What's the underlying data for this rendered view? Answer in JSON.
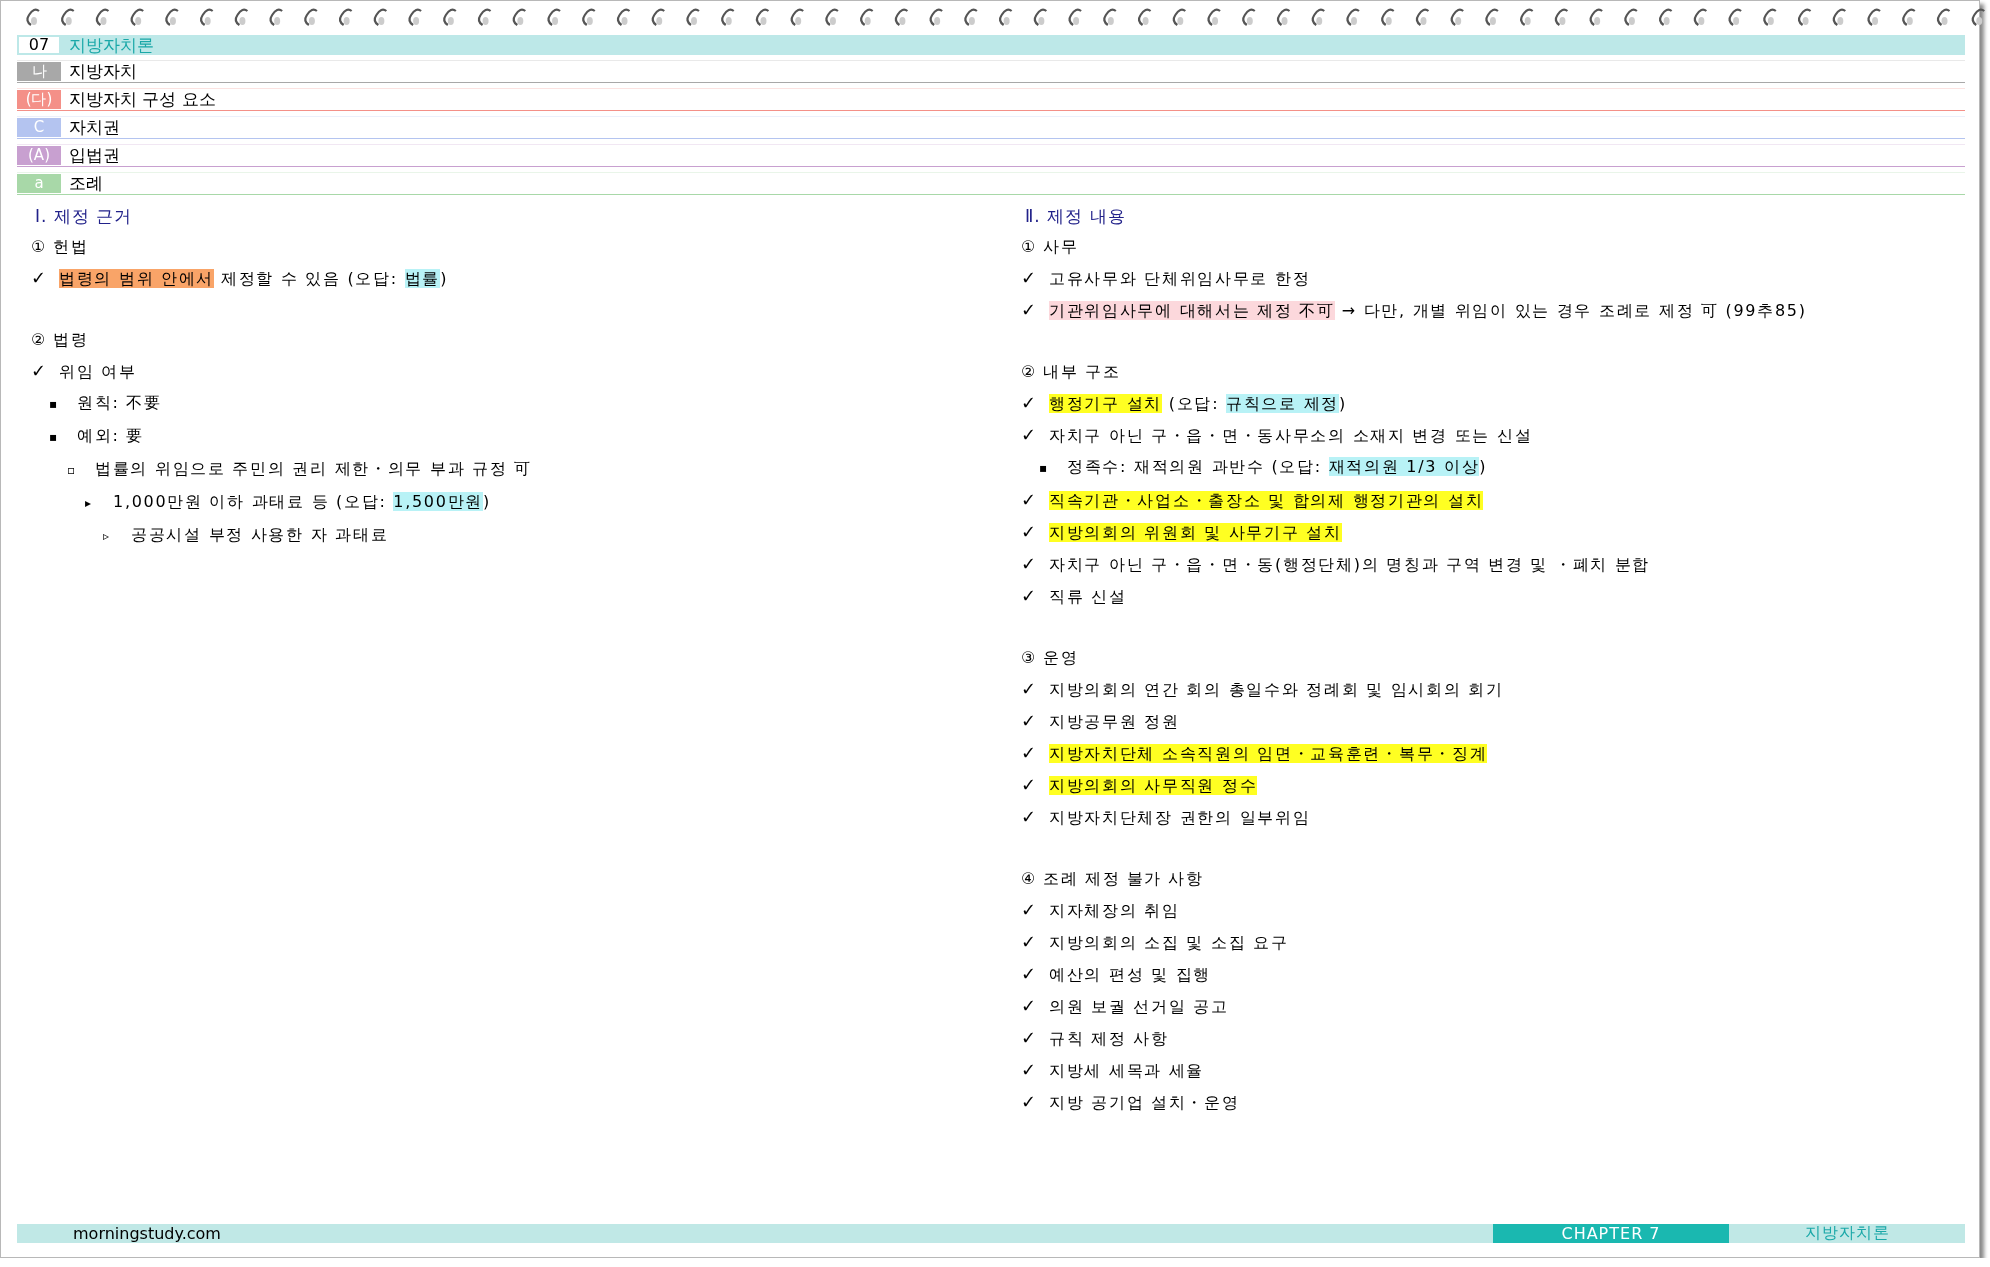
{
  "chapter": {
    "number": "07",
    "title": "지방자치론"
  },
  "crumbs": [
    {
      "marker": "나",
      "label": "지방자치",
      "color": "#a8a8a8"
    },
    {
      "marker": "(다)",
      "label": "지방자치 구성 요소",
      "color": "#f49088"
    },
    {
      "marker": "C",
      "label": "자치권",
      "color": "#b4c4f0"
    },
    {
      "marker": "(A)",
      "label": "입법권",
      "color": "#c8a0d0"
    },
    {
      "marker": "a",
      "label": "조례",
      "color": "#a8d8a8"
    }
  ],
  "columns": [
    {
      "title": "Ⅰ. 제정 근거",
      "sections": [
        {
          "heading": "① 헌법",
          "items": [
            {
              "marker": "✓",
              "segments": [
                {
                  "text": "법령의 범위 안에서",
                  "color": "#f9a468"
                },
                {
                  "text": " 제정할 수 있음 (오답: "
                },
                {
                  "text": "법률",
                  "color": "#b8f2f6"
                },
                {
                  "text": ")"
                }
              ]
            }
          ]
        },
        {
          "heading": "② 법령",
          "items": [
            {
              "marker": "✓",
              "segments": [
                {
                  "text": "위임 여부"
                }
              ],
              "children": [
                {
                  "marker": "▪",
                  "segments": [
                    {
                      "text": "원칙: 不要"
                    }
                  ]
                },
                {
                  "marker": "▪",
                  "segments": [
                    {
                      "text": "예외: 要"
                    }
                  ],
                  "children": [
                    {
                      "marker": "▫",
                      "segments": [
                        {
                          "text": "법률의 위임으로 주민의 권리 제한・의무 부과 규정 可"
                        }
                      ],
                      "children": [
                        {
                          "marker": "▸",
                          "segments": [
                            {
                              "text": "1,000만원 이하 과태료 등 (오답: "
                            },
                            {
                              "text": "1,500만원",
                              "color": "#b8f2f6"
                            },
                            {
                              "text": ")"
                            }
                          ],
                          "children": [
                            {
                              "marker": "▹",
                              "segments": [
                                {
                                  "text": "공공시설 부정 사용한 자 과태료"
                                }
                              ]
                            }
                          ]
                        }
                      ]
                    }
                  ]
                }
              ]
            }
          ]
        }
      ]
    },
    {
      "title": "Ⅱ. 제정 내용",
      "sections": [
        {
          "heading": "① 사무",
          "items": [
            {
              "marker": "✓",
              "segments": [
                {
                  "text": "고유사무와 단체위임사무로 한정"
                }
              ]
            },
            {
              "marker": "✓",
              "segments": [
                {
                  "text": "기관위임사무에 대해서는 제정 不可",
                  "color": "#fcd8dc"
                },
                {
                  "text": " → 다만, 개별 위임이 있는 경우 조례로 제정 可 (99추85)"
                }
              ]
            }
          ]
        },
        {
          "heading": "② 내부 구조",
          "items": [
            {
              "marker": "✓",
              "segments": [
                {
                  "text": "행정기구 설치",
                  "color": "#ffff22"
                },
                {
                  "text": " (오답: "
                },
                {
                  "text": "규칙으로 제정",
                  "color": "#b8f2f6"
                },
                {
                  "text": ")"
                }
              ]
            },
            {
              "marker": "✓",
              "segments": [
                {
                  "text": "자치구 아닌 구・읍・면・동사무소의 소재지 변경 또는 신설"
                }
              ],
              "children": [
                {
                  "marker": "▪",
                  "segments": [
                    {
                      "text": "정족수: 재적의원 과반수 (오답: "
                    },
                    {
                      "text": "재적의원 1/3 이상",
                      "color": "#b8f2f6"
                    },
                    {
                      "text": ")"
                    }
                  ]
                }
              ]
            },
            {
              "marker": "✓",
              "segments": [
                {
                  "text": "직속기관・사업소・출장소 및 합의제 행정기관의 설치",
                  "color": "#ffff22"
                }
              ]
            },
            {
              "marker": "✓",
              "segments": [
                {
                  "text": "지방의회의 위원회 및 사무기구 설치",
                  "color": "#ffff22"
                }
              ]
            },
            {
              "marker": "✓",
              "segments": [
                {
                  "text": "자치구 아닌 구・읍・면・동(행정단체)의 명칭과 구역 변경 및 ・폐치 분합"
                }
              ]
            },
            {
              "marker": "✓",
              "segments": [
                {
                  "text": "직류 신설"
                }
              ]
            }
          ]
        },
        {
          "heading": "③ 운영",
          "items": [
            {
              "marker": "✓",
              "segments": [
                {
                  "text": "지방의회의 연간 회의 총일수와 정례회 및 임시회의 회기"
                }
              ]
            },
            {
              "marker": "✓",
              "segments": [
                {
                  "text": "지방공무원 정원"
                }
              ]
            },
            {
              "marker": "✓",
              "segments": [
                {
                  "text": "지방자치단체 소속직원의 임면・교육훈련・복무・징계",
                  "color": "#ffff22"
                }
              ]
            },
            {
              "marker": "✓",
              "segments": [
                {
                  "text": "지방의회의 사무직원 정수",
                  "color": "#ffff22"
                }
              ]
            },
            {
              "marker": "✓",
              "segments": [
                {
                  "text": "지방자치단체장 권한의 일부위임"
                }
              ]
            }
          ]
        },
        {
          "heading": "④ 조례 제정 불가 사항",
          "items": [
            {
              "marker": "✓",
              "segments": [
                {
                  "text": "지자체장의 취임"
                }
              ]
            },
            {
              "marker": "✓",
              "segments": [
                {
                  "text": "지방의회의 소집 및 소집 요구"
                }
              ]
            },
            {
              "marker": "✓",
              "segments": [
                {
                  "text": "예산의 편성 및 집행"
                }
              ]
            },
            {
              "marker": "✓",
              "segments": [
                {
                  "text": "의원 보궐 선거일 공고"
                }
              ]
            },
            {
              "marker": "✓",
              "segments": [
                {
                  "text": "규칙 제정 사항"
                }
              ]
            },
            {
              "marker": "✓",
              "segments": [
                {
                  "text": "지방세 세목과 세율"
                }
              ]
            },
            {
              "marker": "✓",
              "segments": [
                {
                  "text": "지방 공기업 설치・운영"
                }
              ]
            }
          ]
        }
      ]
    }
  ],
  "footer": {
    "site": "morningstudy.com",
    "chapter": "CHAPTER 7",
    "title": "지방자치론"
  }
}
